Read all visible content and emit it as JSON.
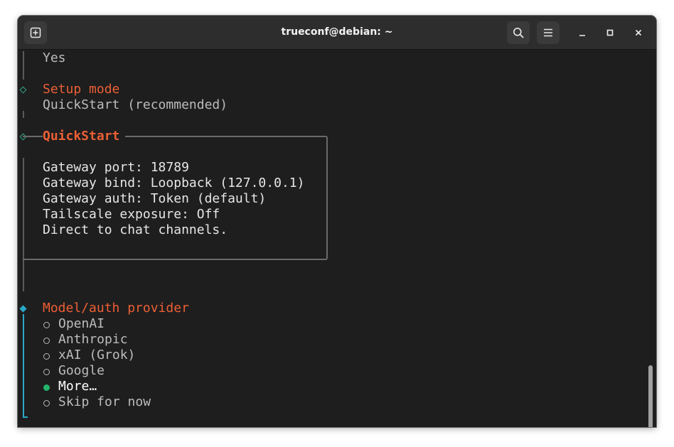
{
  "window": {
    "title": "trueconf@debian: ~"
  },
  "terminal": {
    "prev_answer": "Yes",
    "setup_mode": {
      "heading": "Setup mode",
      "value": "QuickStart (recommended)"
    },
    "quickstart": {
      "heading": "QuickStart",
      "lines": [
        "Gateway port: 18789",
        "Gateway bind: Loopback (127.0.0.1)",
        "Gateway auth: Token (default)",
        "Tailscale exposure: Off",
        "Direct to chat channels."
      ]
    },
    "provider": {
      "heading": "Model/auth provider",
      "options": [
        {
          "label": "OpenAI",
          "selected": false
        },
        {
          "label": "Anthropic",
          "selected": false
        },
        {
          "label": "xAI (Grok)",
          "selected": false
        },
        {
          "label": "Google",
          "selected": false
        },
        {
          "label": "More…",
          "selected": true
        },
        {
          "label": "Skip for now",
          "selected": false
        }
      ]
    }
  },
  "colors": {
    "accent_orange": "#ed5f35",
    "done_marker": "#2ea48a",
    "active_marker": "#2aa8c8",
    "selected_radio": "#23b46b"
  },
  "icons": {
    "new_tab": "new-tab-icon",
    "search": "search-icon",
    "menu": "hamburger-menu-icon",
    "minimize": "minimize-icon",
    "maximize": "maximize-icon",
    "close": "close-icon"
  }
}
